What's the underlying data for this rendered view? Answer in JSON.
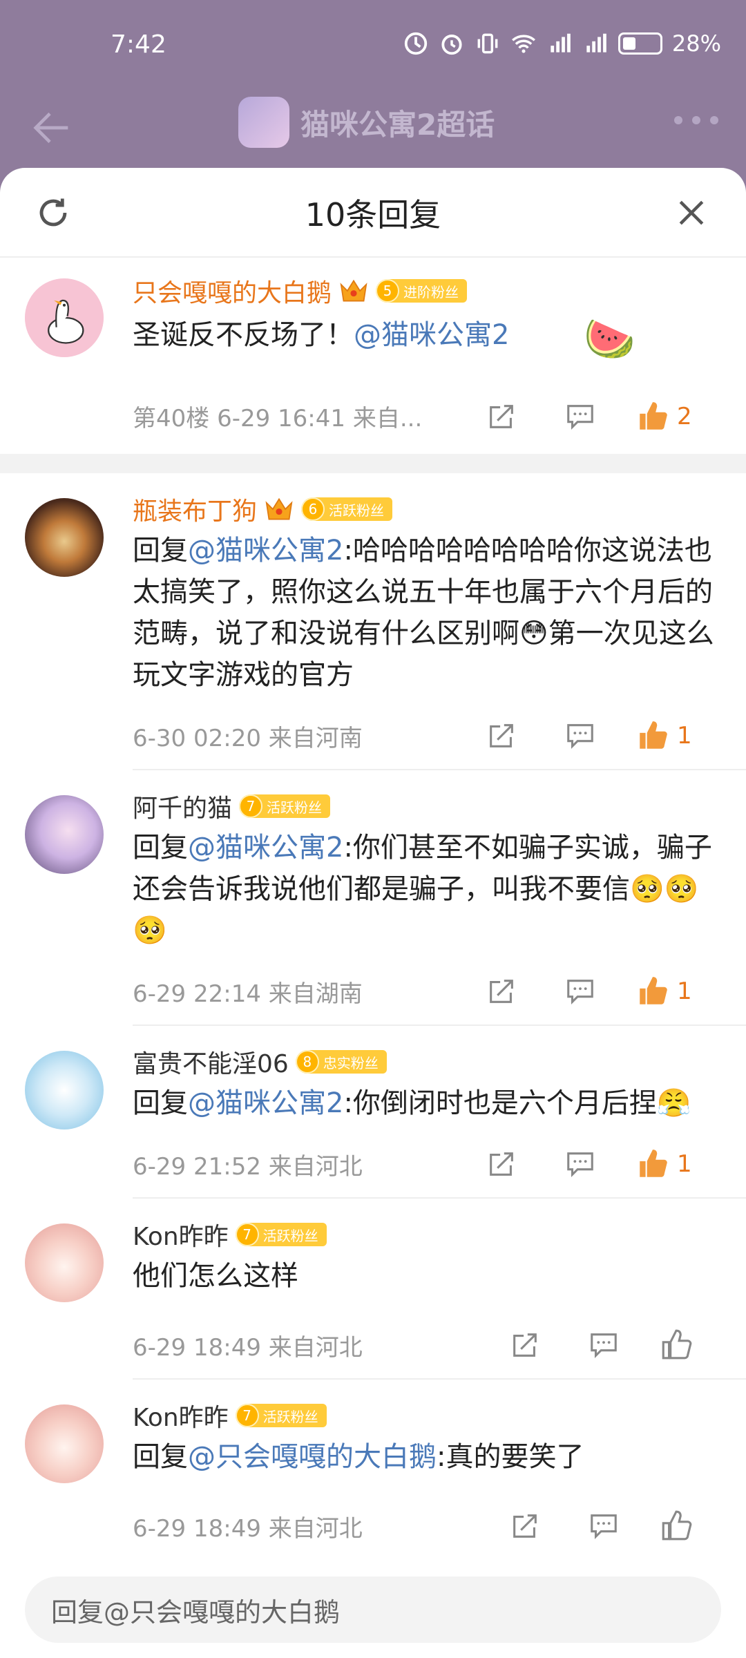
{
  "status": {
    "time": "7:42",
    "battery": "28%",
    "signal1": "3G",
    "signal2": "4G"
  },
  "page": {
    "title": "猫咪公寓2超话"
  },
  "sheet": {
    "title": "10条回复"
  },
  "comments": [
    {
      "name": "只会嘎嘎的大白鹅",
      "vip": true,
      "fan_level": "5",
      "fan_label": "进阶粉丝",
      "mention": "",
      "prefix": "",
      "text": "圣诞反不反场了！",
      "mention_after": "@猫咪公寓2",
      "emoji": "🍉",
      "meta": "第40楼  6-29 16:41  来自...",
      "likes": "2",
      "liked": true
    },
    {
      "name": "瓶装布丁狗",
      "vip": true,
      "fan_level": "6",
      "fan_label": "活跃粉丝",
      "prefix": "回复",
      "mention": "@猫咪公寓2",
      "text": ":哈哈哈哈哈哈哈哈你这说法也太搞笑了，照你这么说五十年也属于六个月后的范畴，说了和没说有什么区别啊😳第一次见这么玩文字游戏的官方",
      "meta": "6-30 02:20  来自河南",
      "likes": "1",
      "liked": true
    },
    {
      "name": "阿千的猫",
      "vip": false,
      "fan_level": "7",
      "fan_label": "活跃粉丝",
      "prefix": "回复",
      "mention": "@猫咪公寓2",
      "text": ":你们甚至不如骗子实诚，骗子还会告诉我说他们都是骗子，叫我不要信🥺🥺🥺",
      "meta": "6-29 22:14  来自湖南",
      "likes": "1",
      "liked": true
    },
    {
      "name": "富贵不能淫06",
      "vip": false,
      "fan_level": "8",
      "fan_label": "忠实粉丝",
      "prefix": "回复",
      "mention": "@猫咪公寓2",
      "text": ":你倒闭时也是六个月后捏😤",
      "meta": "6-29 21:52  来自河北",
      "likes": "1",
      "liked": true
    },
    {
      "name": "Kon昨昨",
      "vip": false,
      "fan_level": "7",
      "fan_label": "活跃粉丝",
      "prefix": "",
      "mention": "",
      "text": "他们怎么这样",
      "meta": "6-29 18:49  来自河北",
      "likes": "",
      "liked": false
    },
    {
      "name": "Kon昨昨",
      "vip": false,
      "fan_level": "7",
      "fan_label": "活跃粉丝",
      "prefix": "回复",
      "mention": "@只会嘎嘎的大白鹅",
      "text": ":真的要笑了",
      "meta": "6-29 18:49  来自河北",
      "likes": "",
      "liked": false
    }
  ],
  "reply_input": {
    "placeholder": "回复@只会嘎嘎的大白鹅"
  },
  "colors": {
    "accent": "#e8761b",
    "mention": "#4a79b8",
    "badge": "#ffcb3a"
  }
}
